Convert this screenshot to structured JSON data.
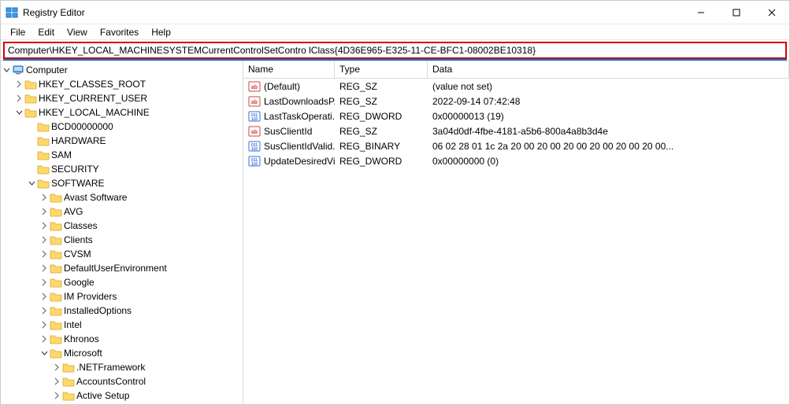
{
  "window": {
    "title": "Registry Editor"
  },
  "menu": {
    "file": "File",
    "edit": "Edit",
    "view": "View",
    "favorites": "Favorites",
    "help": "Help"
  },
  "address": "Computer\\HKEY_LOCAL_MACHINESYSTEMCurrentControlSetContro lClass{4D36E965-E325-11-CE-BFC1-08002BE10318}",
  "tree": [
    {
      "depth": 0,
      "expander": "open",
      "icon": "computer",
      "label": "Computer"
    },
    {
      "depth": 1,
      "expander": "closed",
      "icon": "folder",
      "label": "HKEY_CLASSES_ROOT"
    },
    {
      "depth": 1,
      "expander": "closed",
      "icon": "folder",
      "label": "HKEY_CURRENT_USER"
    },
    {
      "depth": 1,
      "expander": "open",
      "icon": "folder",
      "label": "HKEY_LOCAL_MACHINE"
    },
    {
      "depth": 2,
      "expander": "none",
      "icon": "folder",
      "label": "BCD00000000"
    },
    {
      "depth": 2,
      "expander": "none",
      "icon": "folder",
      "label": "HARDWARE"
    },
    {
      "depth": 2,
      "expander": "none",
      "icon": "folder",
      "label": "SAM"
    },
    {
      "depth": 2,
      "expander": "none",
      "icon": "folder",
      "label": "SECURITY"
    },
    {
      "depth": 2,
      "expander": "open",
      "icon": "folder",
      "label": "SOFTWARE"
    },
    {
      "depth": 3,
      "expander": "closed",
      "icon": "folder",
      "label": "Avast Software"
    },
    {
      "depth": 3,
      "expander": "closed",
      "icon": "folder",
      "label": "AVG"
    },
    {
      "depth": 3,
      "expander": "closed",
      "icon": "folder",
      "label": "Classes"
    },
    {
      "depth": 3,
      "expander": "closed",
      "icon": "folder",
      "label": "Clients"
    },
    {
      "depth": 3,
      "expander": "closed",
      "icon": "folder",
      "label": "CVSM"
    },
    {
      "depth": 3,
      "expander": "closed",
      "icon": "folder",
      "label": "DefaultUserEnvironment"
    },
    {
      "depth": 3,
      "expander": "closed",
      "icon": "folder",
      "label": "Google"
    },
    {
      "depth": 3,
      "expander": "closed",
      "icon": "folder",
      "label": "IM Providers"
    },
    {
      "depth": 3,
      "expander": "closed",
      "icon": "folder",
      "label": "InstalledOptions"
    },
    {
      "depth": 3,
      "expander": "closed",
      "icon": "folder",
      "label": "Intel"
    },
    {
      "depth": 3,
      "expander": "closed",
      "icon": "folder",
      "label": "Khronos"
    },
    {
      "depth": 3,
      "expander": "open",
      "icon": "folder",
      "label": "Microsoft"
    },
    {
      "depth": 4,
      "expander": "closed",
      "icon": "folder",
      "label": ".NETFramework"
    },
    {
      "depth": 4,
      "expander": "closed",
      "icon": "folder",
      "label": "AccountsControl"
    },
    {
      "depth": 4,
      "expander": "closed",
      "icon": "folder",
      "label": "Active Setup"
    }
  ],
  "columns": {
    "name": "Name",
    "type": "Type",
    "data": "Data"
  },
  "values": [
    {
      "icon": "string",
      "name": "(Default)",
      "type": "REG_SZ",
      "data": "(value not set)"
    },
    {
      "icon": "string",
      "name": "LastDownloadsP...",
      "type": "REG_SZ",
      "data": "2022-09-14 07:42:48"
    },
    {
      "icon": "binary",
      "name": "LastTaskOperati...",
      "type": "REG_DWORD",
      "data": "0x00000013 (19)"
    },
    {
      "icon": "string",
      "name": "SusClientId",
      "type": "REG_SZ",
      "data": "3a04d0df-4fbe-4181-a5b6-800a4a8b3d4e"
    },
    {
      "icon": "binary",
      "name": "SusClientIdValid...",
      "type": "REG_BINARY",
      "data": "06 02 28 01 1c 2a 20 00 20 00 20 00 20 00 20 00 20 00..."
    },
    {
      "icon": "binary",
      "name": "UpdateDesiredVi...",
      "type": "REG_DWORD",
      "data": "0x00000000 (0)"
    }
  ]
}
